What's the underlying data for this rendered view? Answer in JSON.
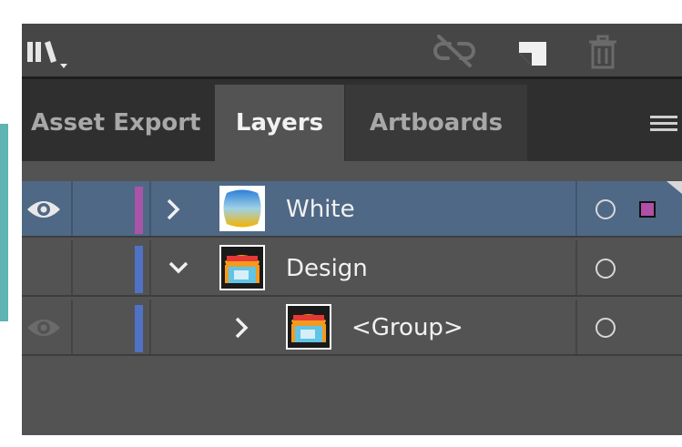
{
  "toolbar": {
    "icons": [
      "libraries-icon",
      "unlink-icon",
      "new-layer-icon",
      "trash-icon"
    ]
  },
  "tabs": [
    {
      "label": "Asset Export",
      "active": false
    },
    {
      "label": "Layers",
      "active": true
    },
    {
      "label": "Artboards",
      "active": false
    }
  ],
  "layers": [
    {
      "name": "White",
      "visible": true,
      "expanded": false,
      "selected": true,
      "color": "#a855a8"
    },
    {
      "name": "Design",
      "visible": false,
      "expanded": true,
      "selected": false,
      "color": "#4f72c4"
    },
    {
      "name": "<Group>",
      "visible": true,
      "expanded": false,
      "selected": false,
      "color": "#4f72c4"
    }
  ],
  "colors": {
    "selected_row": "#4f6885",
    "panel": "#535353",
    "accent_strip": "#5fb3b0"
  }
}
